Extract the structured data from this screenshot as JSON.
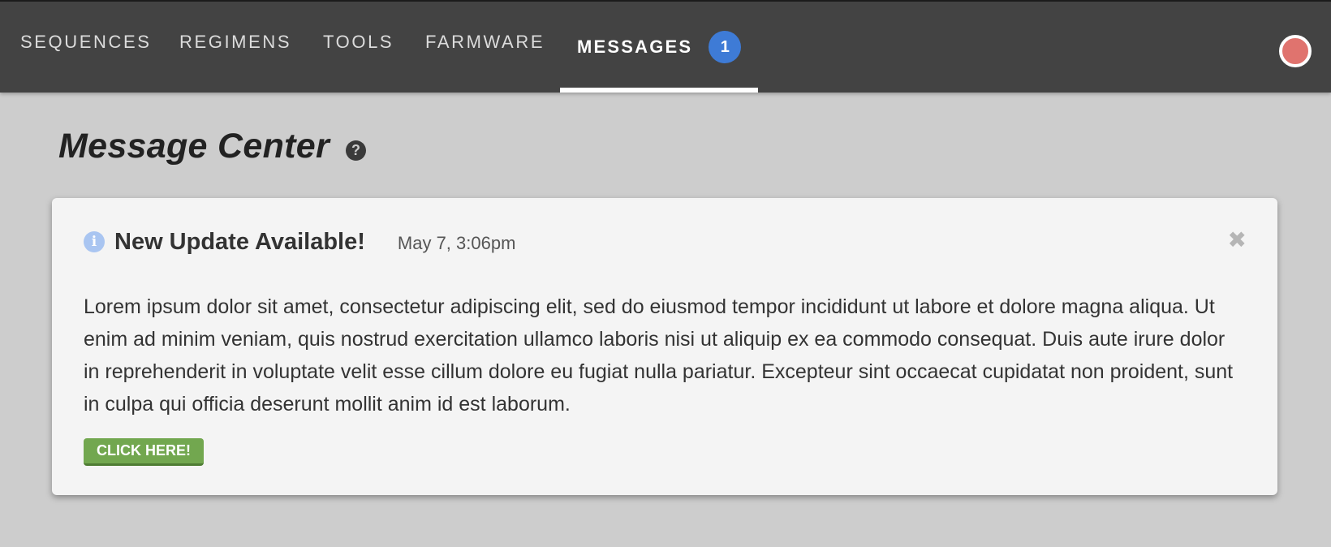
{
  "nav": {
    "items": [
      {
        "label": "SEQUENCES"
      },
      {
        "label": "REGIMENS"
      },
      {
        "label": "TOOLS"
      },
      {
        "label": "FARMWARE"
      },
      {
        "label": "MESSAGES",
        "active": true
      }
    ],
    "messages_badge": "1",
    "status_dot_color": "#e0736e"
  },
  "page": {
    "title": "Message Center",
    "help_icon": "question-circle-icon"
  },
  "message": {
    "icon": "info-circle-icon",
    "title": "New Update Available!",
    "time": "May 7, 3:06pm",
    "body": "Lorem ipsum dolor sit amet, consectetur adipiscing elit, sed do eiusmod tempor incididunt ut labore et dolore magna aliqua. Ut enim ad minim veniam, quis nostrud exercitation ullamco laboris nisi ut aliquip ex ea commodo consequat. Duis aute irure dolor in reprehenderit in voluptate velit esse cillum dolore eu fugiat nulla pariatur. Excepteur sint occaecat cupidatat non proident, sunt in culpa qui officia deserunt mollit anim id est laborum.",
    "button_label": "CLICK HERE!",
    "button_color": "#72a74f"
  },
  "colors": {
    "nav_bg": "#434343",
    "page_bg": "#cdcdcd",
    "badge": "#3e7bd6"
  }
}
